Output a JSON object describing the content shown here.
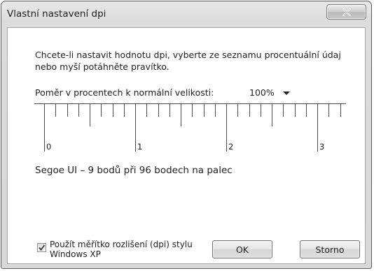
{
  "window": {
    "title": "Vlastní nastavení dpi"
  },
  "dialog": {
    "prompt_text": "Chcete-li nastavit hodnotu dpi, vyberte ze seznamu procentuální údaj nebo myší potáhněte pravítko.",
    "ratio_label": "Poměr v procentech k normální velikosti:",
    "dpi_select": {
      "value": "100%"
    },
    "ruler": {
      "labels": [
        "0",
        "1",
        "2",
        "3"
      ],
      "unit": "inch"
    },
    "sample_text": "Segoe UI – 9 bodů při 96 bodech na palec",
    "xp_checkbox": {
      "checked": true,
      "label": "Použít měřítko rozlišení (dpi) stylu Windows XP"
    },
    "buttons": {
      "ok": "OK",
      "cancel": "Storno"
    }
  },
  "colors": {
    "close_glyph": "#ffffff",
    "frame": "#d8d8d8"
  },
  "icons": {
    "close": "close-icon",
    "dropdown": "chevron-down-icon",
    "checkmark": "checkmark-icon"
  }
}
